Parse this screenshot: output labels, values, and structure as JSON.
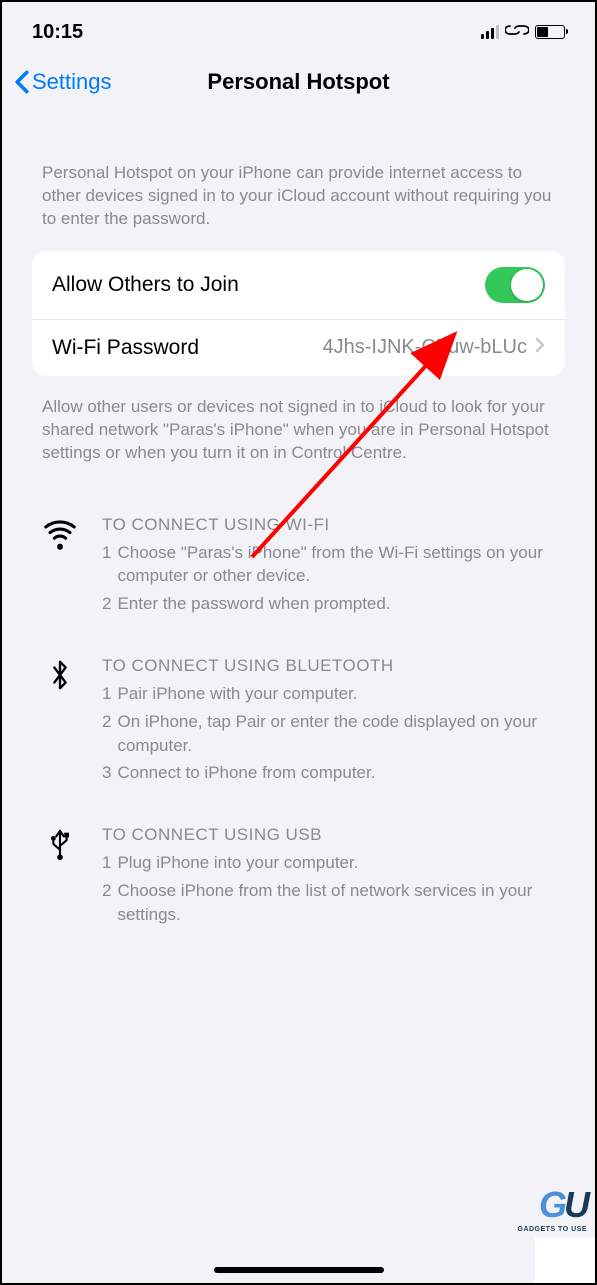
{
  "status": {
    "time": "10:15"
  },
  "nav": {
    "back_label": "Settings",
    "title": "Personal Hotspot"
  },
  "intro": "Personal Hotspot on your iPhone can provide internet access to other devices signed in to your iCloud account without requiring you to enter the password.",
  "rows": {
    "allow_label": "Allow Others to Join",
    "wifi_label": "Wi-Fi Password",
    "wifi_value": "4Jhs-IJNK-CZuw-bLUc"
  },
  "footer": "Allow other users or devices not signed in to iCloud to look for your shared network \"Paras's iPhone\" when you are in Personal Hotspot settings or when you turn it on in Control Centre.",
  "instructions": {
    "wifi": {
      "title": "TO CONNECT USING WI-FI",
      "steps": [
        "Choose \"Paras's iPhone\" from the Wi-Fi settings on your computer or other device.",
        "Enter the password when prompted."
      ]
    },
    "bluetooth": {
      "title": "TO CONNECT USING BLUETOOTH",
      "steps": [
        "Pair iPhone with your computer.",
        "On iPhone, tap Pair or enter the code displayed on your computer.",
        "Connect to iPhone from computer."
      ]
    },
    "usb": {
      "title": "TO CONNECT USING USB",
      "steps": [
        "Plug iPhone into your computer.",
        "Choose iPhone from the list of network services in your settings."
      ]
    }
  },
  "watermark": {
    "sub": "GADGETS TO USE"
  }
}
